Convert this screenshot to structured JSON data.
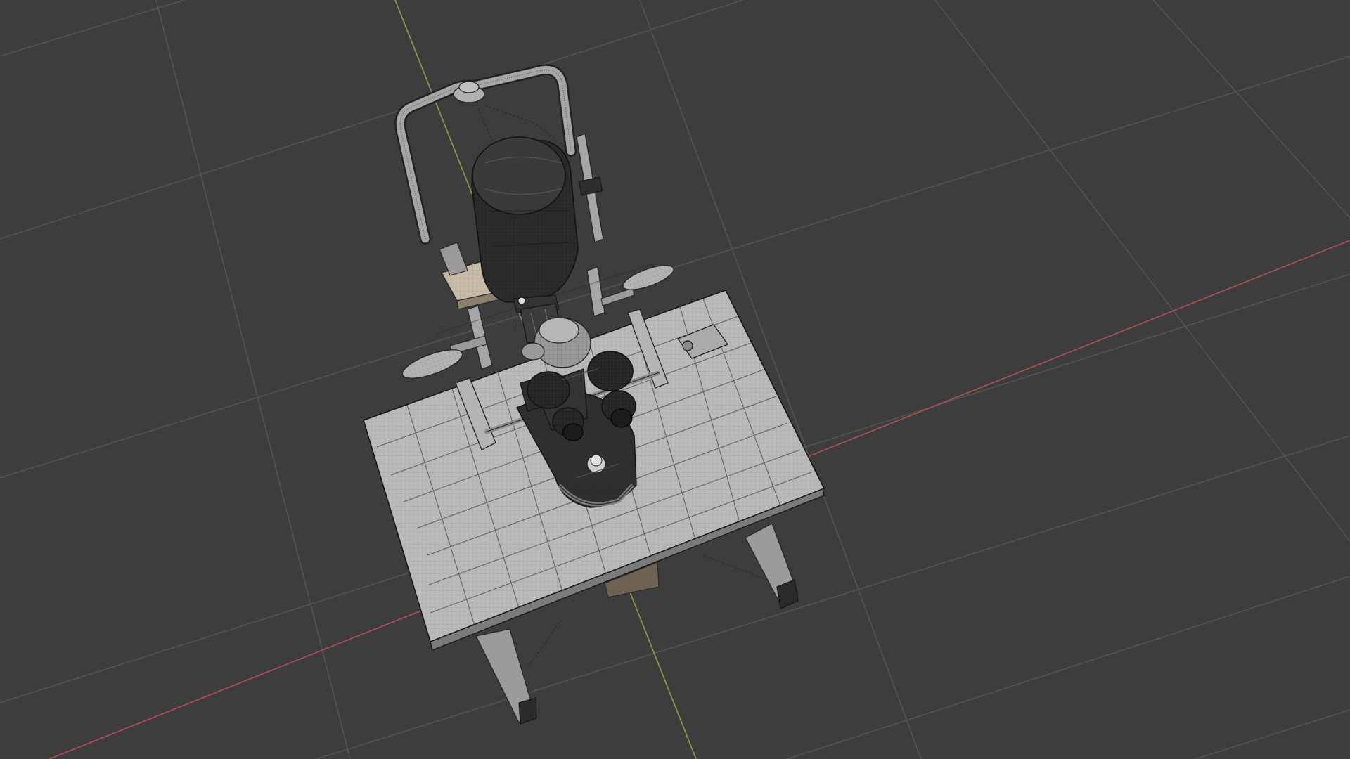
{
  "viewport": {
    "shading_mode": "solid-wireframe",
    "background_color": "#3d3d3d",
    "grid_color": "#5a5a5a",
    "x_axis_color": "#c0505a",
    "y_axis_color": "#8fb04a",
    "subject": "slit-lamp-3d-model"
  },
  "model": {
    "table_color": "#b9bbbb",
    "body_color": "#2e2e2e",
    "metal_color": "#a4a4a4",
    "wood_color": "#c9bca8"
  }
}
